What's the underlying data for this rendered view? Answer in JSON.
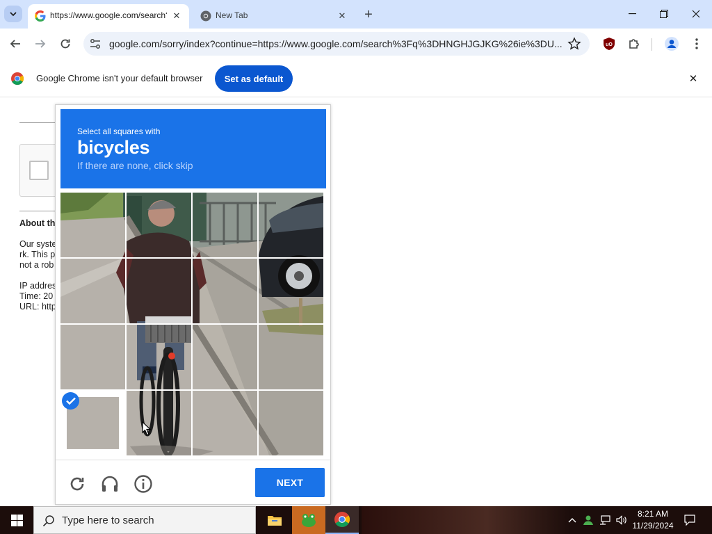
{
  "browser": {
    "tabs": [
      {
        "title": "https://www.google.com/search?q",
        "active": true
      },
      {
        "title": "New Tab",
        "active": false
      }
    ],
    "url": "google.com/sorry/index?continue=https://www.google.com/search%3Fq%3DHNGHJGJKG%26ie%3DU...",
    "infobar": {
      "message": "Google Chrome isn't your default browser",
      "button": "Set as default"
    }
  },
  "page": {
    "about_heading": "About th",
    "lines": [
      "Our syste",
      "rk. This p",
      "not a rob",
      "",
      "IP addres",
      "Time: 20",
      "URL: http"
    ]
  },
  "captcha": {
    "instruction": "Select all squares with",
    "target": "bicycles",
    "hint": "If there are none, click skip",
    "next_label": "NEXT",
    "selected_tiles": [
      12
    ],
    "colors": {
      "accent": "#1a73e8"
    }
  },
  "taskbar": {
    "search_placeholder": "Type here to search",
    "time": "8:21 AM",
    "date": "11/29/2024"
  }
}
